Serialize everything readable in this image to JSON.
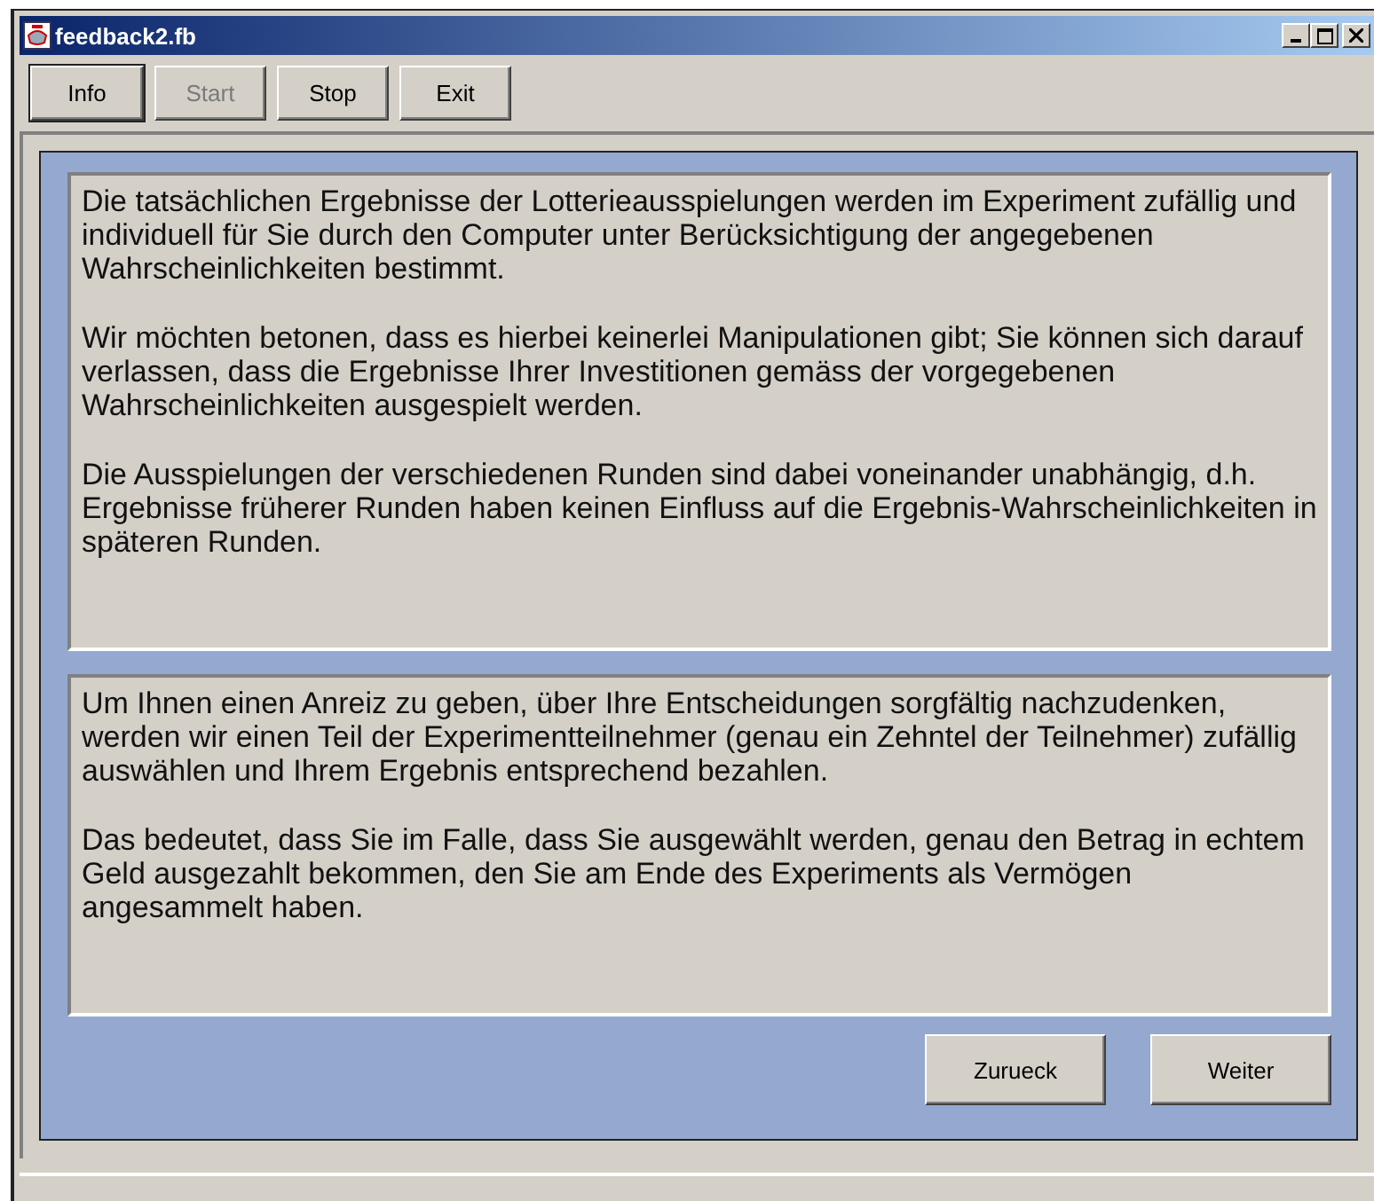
{
  "window": {
    "title": "feedback2.fb"
  },
  "toolbar": [
    {
      "label": "Info",
      "disabled": false
    },
    {
      "label": "Start",
      "disabled": true
    },
    {
      "label": "Stop",
      "disabled": false
    },
    {
      "label": "Exit",
      "disabled": false
    }
  ],
  "panels": [
    {
      "paragraphs": [
        "Die tatsächlichen Ergebnisse der Lotterieausspielungen werden im Experiment zufällig und individuell für Sie durch den Computer unter Berücksichtigung der angegebenen Wahrscheinlichkeiten bestimmt.",
        "Wir möchten betonen, dass es hierbei keinerlei Manipulationen gibt; Sie können sich darauf verlassen, dass die Ergebnisse Ihrer Investitionen gemäss der vorgegebenen Wahrscheinlichkeiten ausgespielt werden.",
        "Die Ausspielungen der verschiedenen Runden sind dabei voneinander unabhängig, d.h. Ergebnisse früherer Runden haben keinen Einfluss auf die Ergebnis-Wahrscheinlichkeiten in späteren Runden."
      ]
    },
    {
      "paragraphs": [
        "Um Ihnen einen Anreiz zu geben, über Ihre Entscheidungen sorgfältig nachzudenken, werden wir einen Teil der Experimentteilnehmer (genau ein Zehntel der Teilnehmer) zufällig auswählen und Ihrem Ergebnis entsprechend bezahlen.",
        "Das bedeutet, dass Sie im Falle, dass Sie ausgewählt werden, genau den Betrag in echtem Geld ausgezahlt bekommen, den Sie am Ende des Experiments als Vermögen angesammelt haben."
      ]
    }
  ],
  "nav_buttons": [
    "Zurueck",
    "Weiter"
  ]
}
